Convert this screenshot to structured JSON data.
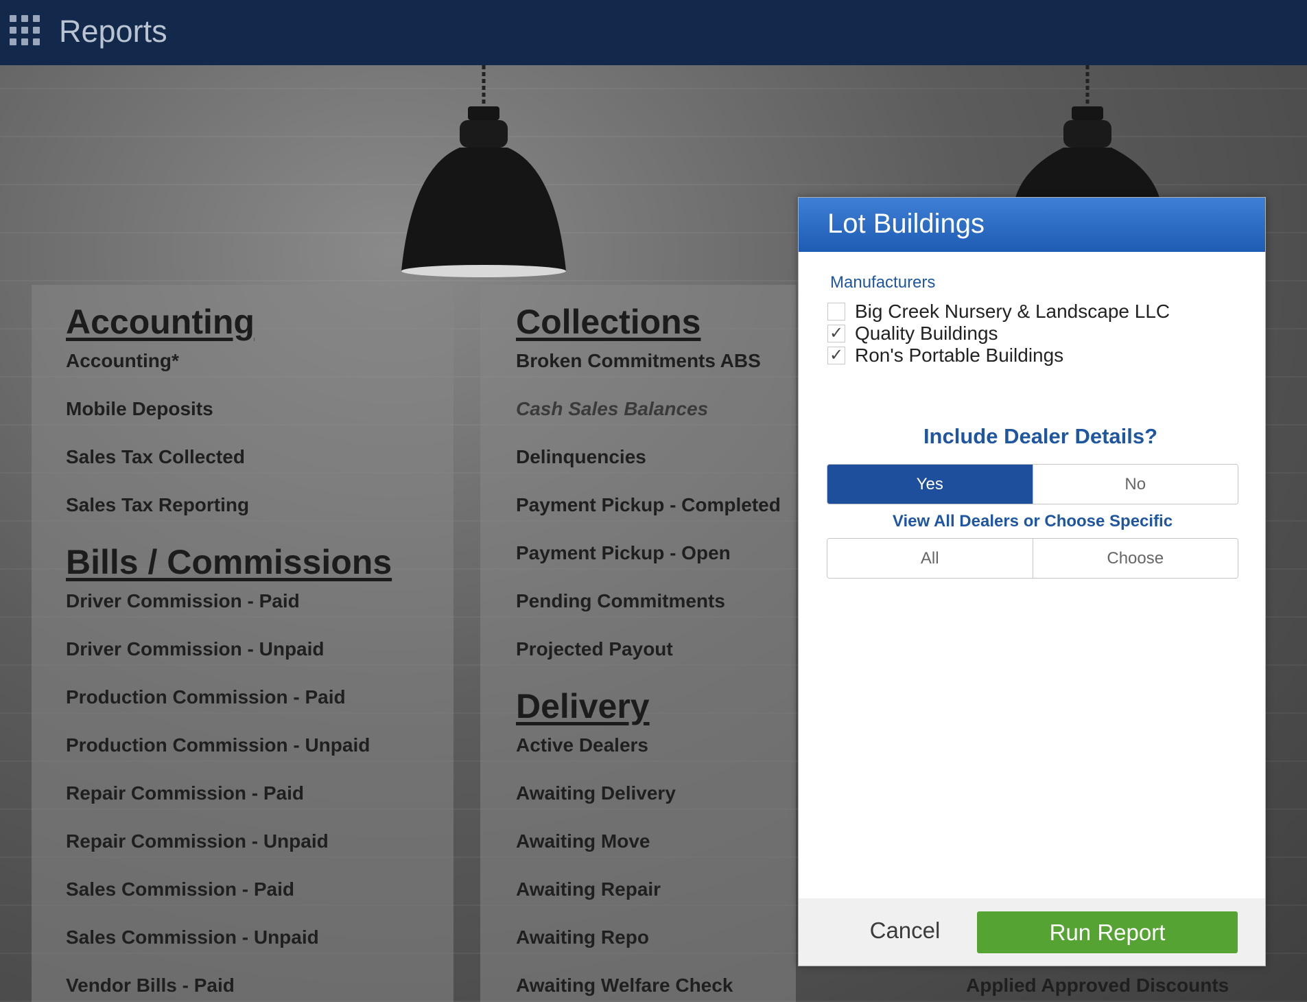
{
  "header": {
    "app_title": "Reports",
    "apps_icon": "grid-icon"
  },
  "columns": {
    "col1": {
      "sections": [
        {
          "title": "Accounting",
          "items": [
            "Accounting*",
            "Mobile Deposits",
            "Sales Tax Collected",
            "Sales Tax Reporting"
          ]
        },
        {
          "title": "Bills / Commissions",
          "items": [
            "Driver Commission - Paid",
            "Driver Commission - Unpaid",
            "Production Commission - Paid",
            "Production Commission - Unpaid",
            "Repair Commission - Paid",
            "Repair Commission - Unpaid",
            "Sales Commission - Paid",
            "Sales Commission - Unpaid",
            "Vendor Bills - Paid"
          ]
        }
      ]
    },
    "col2": {
      "sections": [
        {
          "title": "Collections",
          "items": [
            "Broken Commitments ABS",
            "Cash Sales Balances",
            "Delinquencies",
            "Payment Pickup - Completed",
            "Payment Pickup - Open",
            "Pending Commitments",
            "Projected Payout"
          ]
        },
        {
          "title": "Delivery",
          "items": [
            "Active Dealers",
            "Awaiting Delivery",
            "Awaiting Move",
            "Awaiting Repair",
            "Awaiting Repo",
            "Awaiting Welfare Check"
          ]
        }
      ]
    },
    "col3": {
      "visible_items": [
        "Applied Approved Discounts"
      ]
    }
  },
  "modal": {
    "title": "Lot Buildings",
    "manufacturers_label": "Manufacturers",
    "manufacturers": [
      {
        "name": "Big Creek Nursery & Landscape LLC",
        "checked": false
      },
      {
        "name": "Quality Buildings",
        "checked": true
      },
      {
        "name": "Ron's Portable Buildings",
        "checked": true
      }
    ],
    "check_glyph": "✓",
    "dealer_question": "Include Dealer Details?",
    "dealer_options": [
      "Yes",
      "No"
    ],
    "dealer_selected": "Yes",
    "view_label": "View All Dealers or Choose Specific",
    "view_options": [
      "All",
      "Choose"
    ],
    "cancel_label": "Cancel",
    "run_label": "Run Report"
  },
  "colors": {
    "topbar": "#13294b",
    "modal_header": "#2a6cc4",
    "accent_text": "#1f56a0",
    "selected_segment": "#1e4f9c",
    "run_button": "#55a333"
  }
}
